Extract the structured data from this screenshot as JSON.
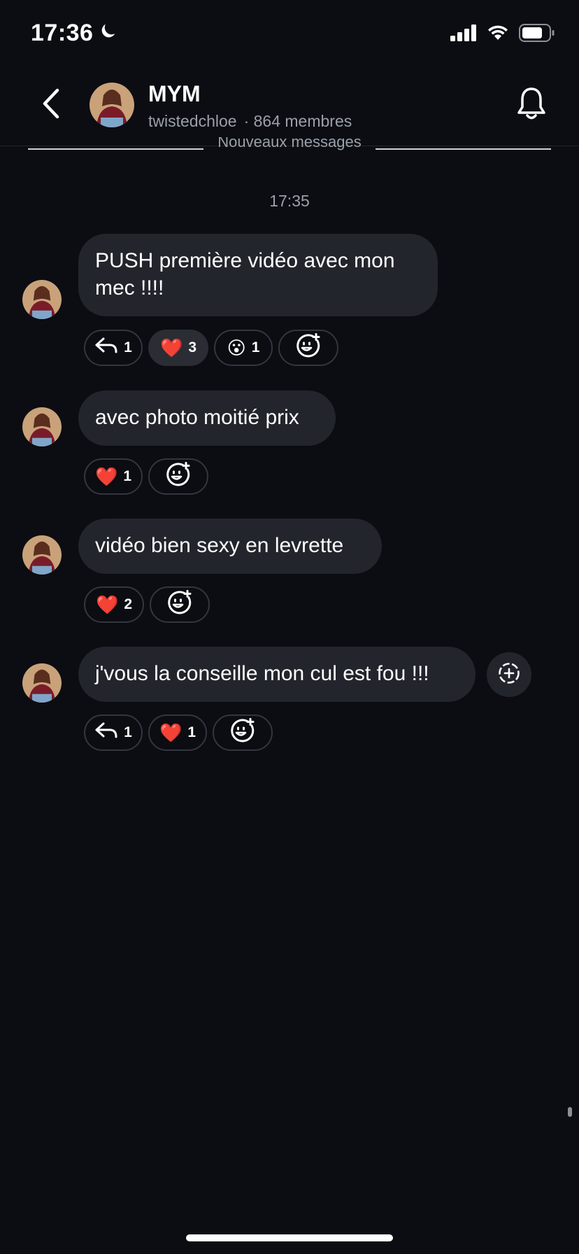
{
  "status_bar": {
    "time": "17:36",
    "moon_icon": "moon-icon",
    "signal_icon": "signal-icon",
    "wifi_icon": "wifi-icon",
    "battery_icon": "battery-icon"
  },
  "header": {
    "title": "MYM",
    "username": "twistedchloe",
    "members": "· 864 membres",
    "back_icon": "chevron-left-icon",
    "bell_icon": "bell-icon"
  },
  "divider": {
    "label": "Nouveaux messages"
  },
  "timestamp": "17:35",
  "messages": [
    {
      "line1": "PUSH première vidéo avec mon",
      "line2": "mec !!!!",
      "reactions": [
        {
          "icon": "reply-icon",
          "count": "1"
        },
        {
          "emoji": "❤️",
          "count": "3"
        },
        {
          "emoji": "😮",
          "count": "1"
        }
      ]
    },
    {
      "text": "avec photo moitié prix",
      "reactions": [
        {
          "emoji": "❤️",
          "count": "1"
        }
      ]
    },
    {
      "text": "vidéo bien sexy en levrette",
      "reactions": [
        {
          "emoji": "❤️",
          "count": "2"
        }
      ]
    },
    {
      "text": "j'vous la conseille mon cul est fou !!!",
      "reactions": [
        {
          "icon": "reply-icon",
          "count": "1"
        },
        {
          "emoji": "❤️",
          "count": "1"
        }
      ]
    }
  ],
  "colors": {
    "background": "#0b0d12",
    "bubble": "#22252b",
    "muted_text": "#9aa0aa"
  }
}
